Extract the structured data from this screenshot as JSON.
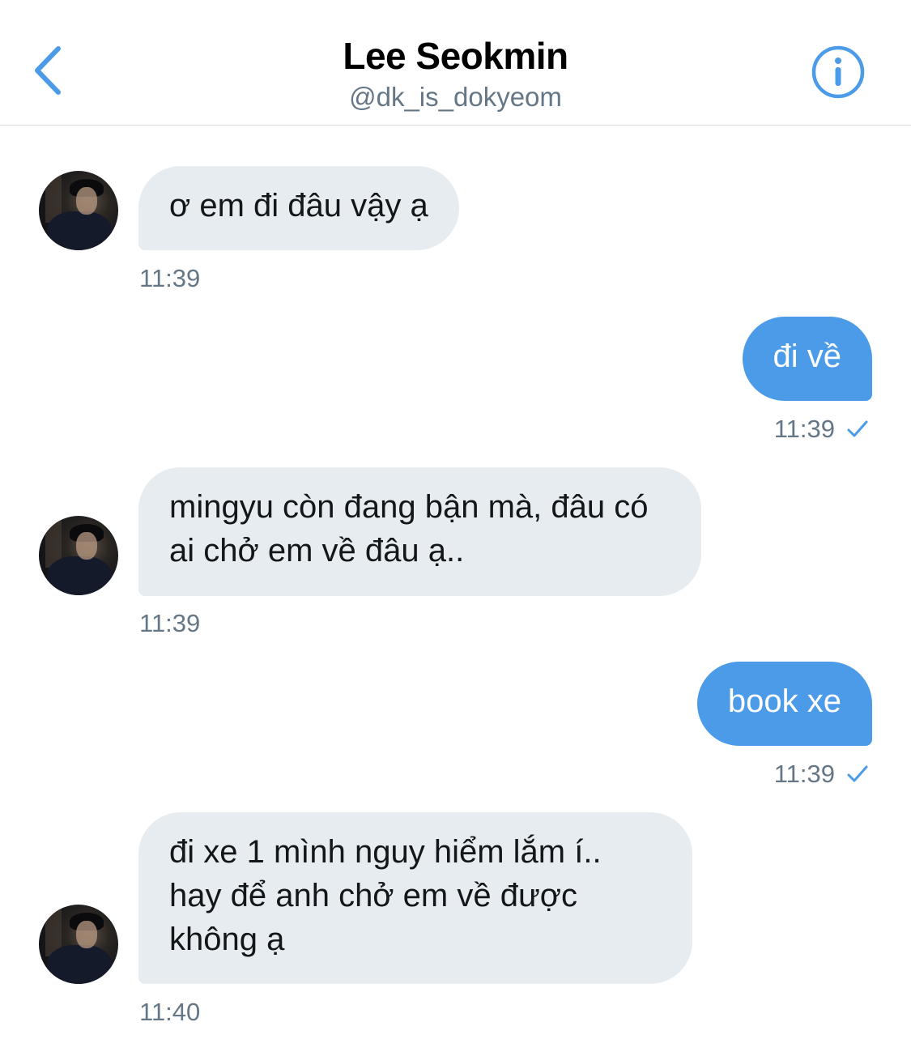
{
  "header": {
    "title": "Lee Seokmin",
    "handle": "@dk_is_dokyeom",
    "accent_color": "#4c9be8"
  },
  "messages": [
    {
      "side": "incoming",
      "text": "ơ em đi đâu vậy ạ",
      "time": "11:39"
    },
    {
      "side": "outgoing",
      "text": "đi về",
      "time": "11:39",
      "status_icon": "check-icon"
    },
    {
      "side": "incoming",
      "text": "mingyu còn đang bận mà, đâu có ai chở em về đâu ạ..",
      "time": "11:39"
    },
    {
      "side": "outgoing",
      "text": "book xe",
      "time": "11:39",
      "status_icon": "check-icon"
    },
    {
      "side": "incoming",
      "text": "đi xe 1 mình nguy hiểm lắm í.. hay để anh chở em về được không ạ",
      "time": "11:40"
    }
  ],
  "colors": {
    "incoming_bubble": "#e6ecf0",
    "outgoing_bubble": "#4c9be8",
    "timestamp": "#657786"
  }
}
